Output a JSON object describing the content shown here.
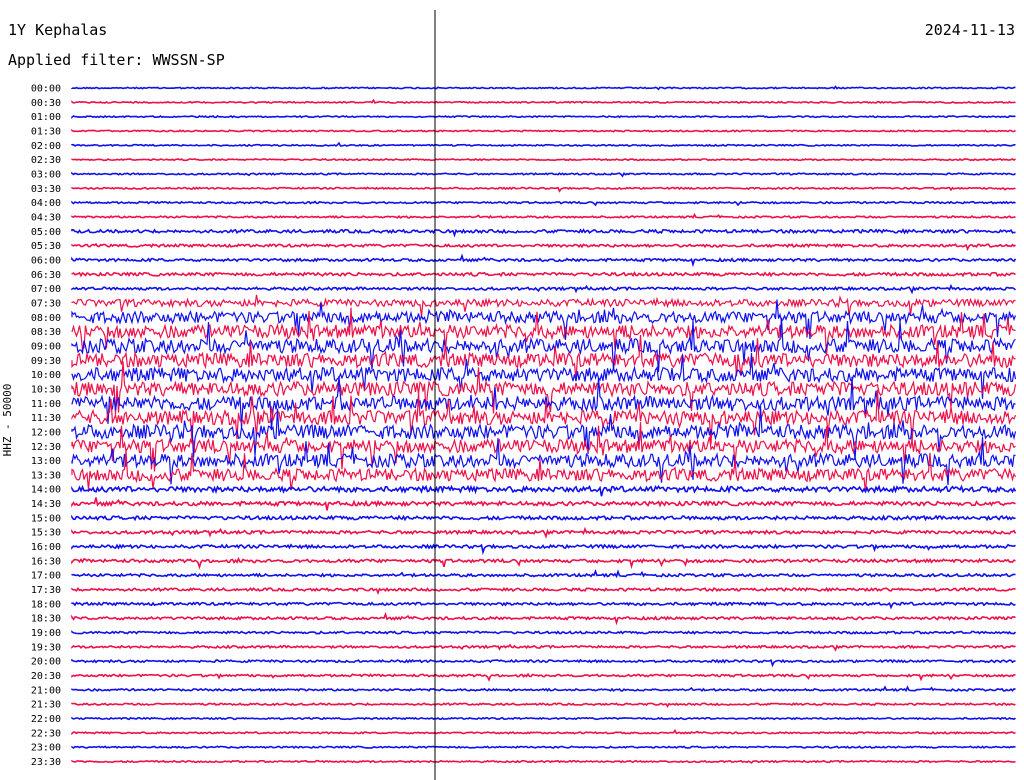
{
  "header": {
    "station": "1Y Kephalas",
    "date": "2024-11-13",
    "filter": "Applied filter: WWSSN-SP"
  },
  "colors": {
    "trace_a": "#1010ee",
    "trace_b": "#ee1048",
    "background": "#ffffff"
  },
  "chart_data": {
    "type": "line",
    "title": "1Y Kephalas",
    "subtitle": "Applied filter: WWSSN-SP",
    "ylabel": "HHZ - 50000",
    "row_labels": [
      "00:00",
      "00:30",
      "01:00",
      "01:30",
      "02:00",
      "02:30",
      "03:00",
      "03:30",
      "04:00",
      "04:30",
      "05:00",
      "05:30",
      "06:00",
      "06:30",
      "07:00",
      "07:30",
      "08:00",
      "08:30",
      "09:00",
      "09:30",
      "10:00",
      "10:30",
      "11:00",
      "11:30",
      "12:00",
      "12:30",
      "13:00",
      "13:30",
      "14:00",
      "14:30",
      "15:00",
      "15:30",
      "16:00",
      "16:30",
      "17:00",
      "17:30",
      "18:00",
      "18:30",
      "19:00",
      "19:30",
      "20:00",
      "20:30",
      "21:00",
      "21:30",
      "22:00",
      "22:30",
      "23:00",
      "23:30"
    ],
    "row_colors": [
      "blue",
      "red"
    ],
    "activity_level": [
      0.3,
      0.3,
      0.3,
      0.3,
      0.3,
      0.3,
      0.35,
      0.35,
      0.4,
      0.4,
      0.7,
      0.6,
      0.6,
      0.7,
      0.6,
      1.6,
      2.6,
      3.0,
      3.2,
      3.2,
      3.2,
      3.2,
      3.2,
      3.2,
      3.2,
      3.0,
      3.0,
      2.8,
      1.2,
      0.9,
      0.8,
      0.7,
      0.7,
      0.7,
      0.6,
      0.6,
      0.6,
      0.6,
      0.5,
      0.5,
      0.5,
      0.5,
      0.45,
      0.4,
      0.35,
      0.35,
      0.35,
      0.35
    ],
    "grid": false
  }
}
